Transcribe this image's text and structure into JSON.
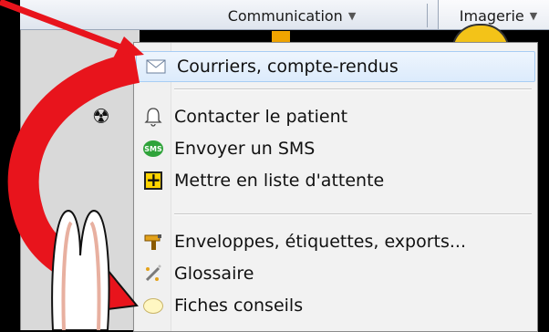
{
  "toolbar": {
    "tabs": [
      {
        "label": "Communication"
      },
      {
        "label": "Imagerie"
      }
    ]
  },
  "menu": {
    "items": [
      {
        "label": "Courriers, compte-rendus",
        "icon": "envelope-icon",
        "highlighted": true
      },
      {
        "label": "Contacter le patient",
        "icon": "bell-icon"
      },
      {
        "label": "Envoyer un SMS",
        "icon": "sms-icon",
        "icon_text": "SMS"
      },
      {
        "label": "Mettre en liste d'attente",
        "icon": "plus-box-icon"
      },
      {
        "label": "Enveloppes, étiquettes, exports...",
        "icon": "label-gun-icon"
      },
      {
        "label": "Glossaire",
        "icon": "wand-icon"
      },
      {
        "label": "Fiches conseils",
        "icon": "speech-bubble-icon"
      }
    ]
  },
  "colors": {
    "highlight_bg": "#dcebfc",
    "highlight_border": "#a8cdf4",
    "arrow_red": "#e8141c"
  }
}
